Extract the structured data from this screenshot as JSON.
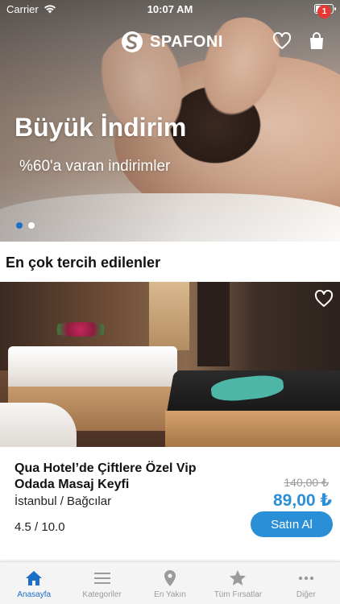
{
  "status_bar": {
    "carrier": "Carrier",
    "time": "10:07 AM"
  },
  "header": {
    "brand": "SPAFONI",
    "cart_count": "1"
  },
  "hero": {
    "title": "Büyük İndirim",
    "subtitle": "%60'a varan indirimler",
    "slide_count": 2,
    "active_slide": 1
  },
  "section": {
    "title": "En çok tercih edilenler"
  },
  "card": {
    "title": "Qua Hotel’de Çiftlere Özel Vip Odada Masaj Keyfi",
    "location": "İstanbul / Bağcılar",
    "rating": "4.5 / 10.0",
    "old_price": "140,00 ₺",
    "new_price": "89,00 ₺",
    "buy_label": "Satın Al"
  },
  "tabbar": {
    "tabs": [
      {
        "label": "Anasayfa",
        "icon": "home-icon",
        "active": true
      },
      {
        "label": "Kategoriler",
        "icon": "list-icon",
        "active": false
      },
      {
        "label": "En Yakın",
        "icon": "location-pin-icon",
        "active": false
      },
      {
        "label": "Tüm Fırsatlar",
        "icon": "star-icon",
        "active": false
      },
      {
        "label": "Diğer",
        "icon": "more-icon",
        "active": false
      }
    ]
  },
  "colors": {
    "accent": "#2a8fd6",
    "active_tab": "#1d6fc7",
    "badge": "#e53935"
  }
}
